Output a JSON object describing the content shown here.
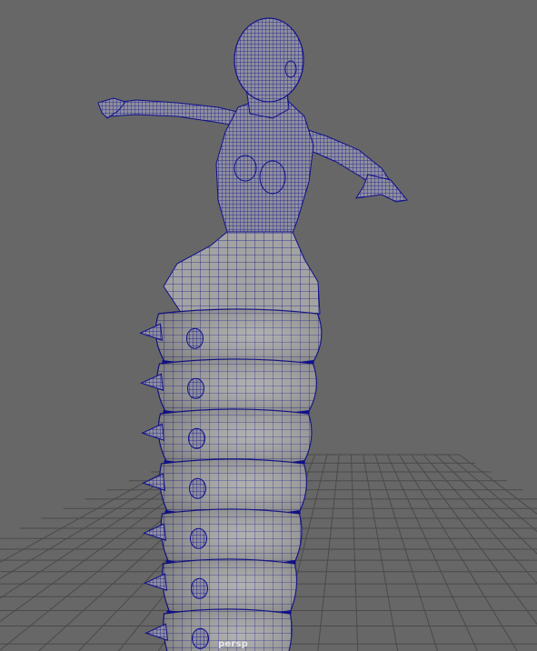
{
  "viewport": {
    "camera_name": "persp",
    "background_color": "#676767",
    "grid_color": "#4a4a4a",
    "grid_major_color": "#3c3c3c",
    "mesh_fill_color": "#9a9a9a",
    "wireframe_color": "#10108a"
  },
  "model": {
    "description_icon": "wireframe-mesh-icon",
    "segment_count": 7
  }
}
